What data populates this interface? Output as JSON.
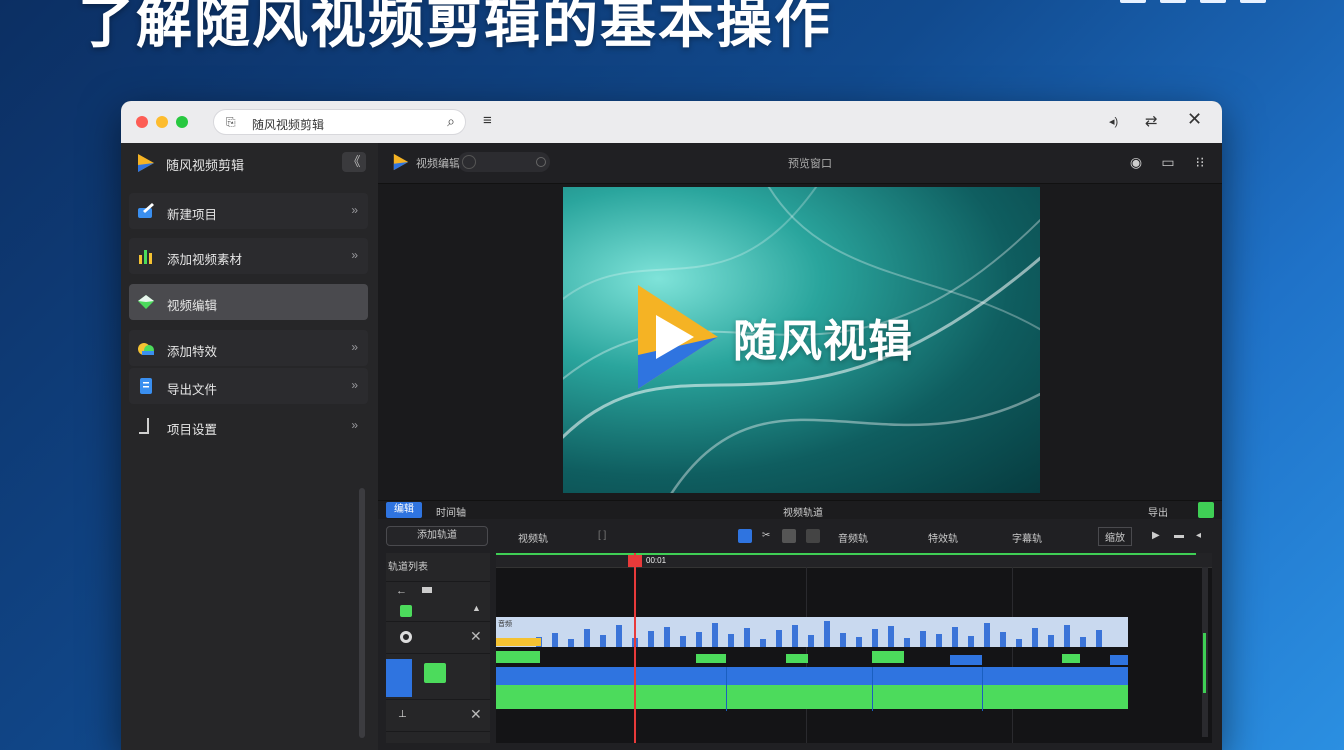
{
  "headline": "了解随风视频剪辑的基本操作",
  "browser": {
    "url": "随风视频剪辑"
  },
  "sidebar": {
    "title": "随风视频剪辑",
    "items": [
      {
        "label": "新建项目",
        "icon": "edit-icon"
      },
      {
        "label": "添加视频素材",
        "icon": "bar-chart-icon"
      },
      {
        "label": "视频编辑",
        "icon": "diamond-icon"
      },
      {
        "label": "添加特效",
        "icon": "cloud-icon"
      },
      {
        "label": "导出文件",
        "icon": "document-icon"
      },
      {
        "label": "项目设置",
        "icon": "ruler-icon"
      }
    ]
  },
  "main": {
    "header_label": "视频编辑",
    "header_center": "预览窗口"
  },
  "preview": {
    "brand_text": "随风视辑"
  },
  "timeline": {
    "tab_active": "编辑",
    "tab2": "时间轴",
    "center": "视频轨道",
    "right": "导出",
    "toolbar": {
      "button": "添加轨道",
      "label1": "视频轨",
      "label2": "音频轨",
      "label3": "特效轨",
      "label4": "字幕轨",
      "label5": "缩放"
    },
    "track_title": "轨道列表",
    "playhead_label": "00:01",
    "audio_label": "音频"
  },
  "colors": {
    "accent_blue": "#2f74e0",
    "accent_green": "#4cdb5c",
    "playhead": "#e83a3a"
  }
}
